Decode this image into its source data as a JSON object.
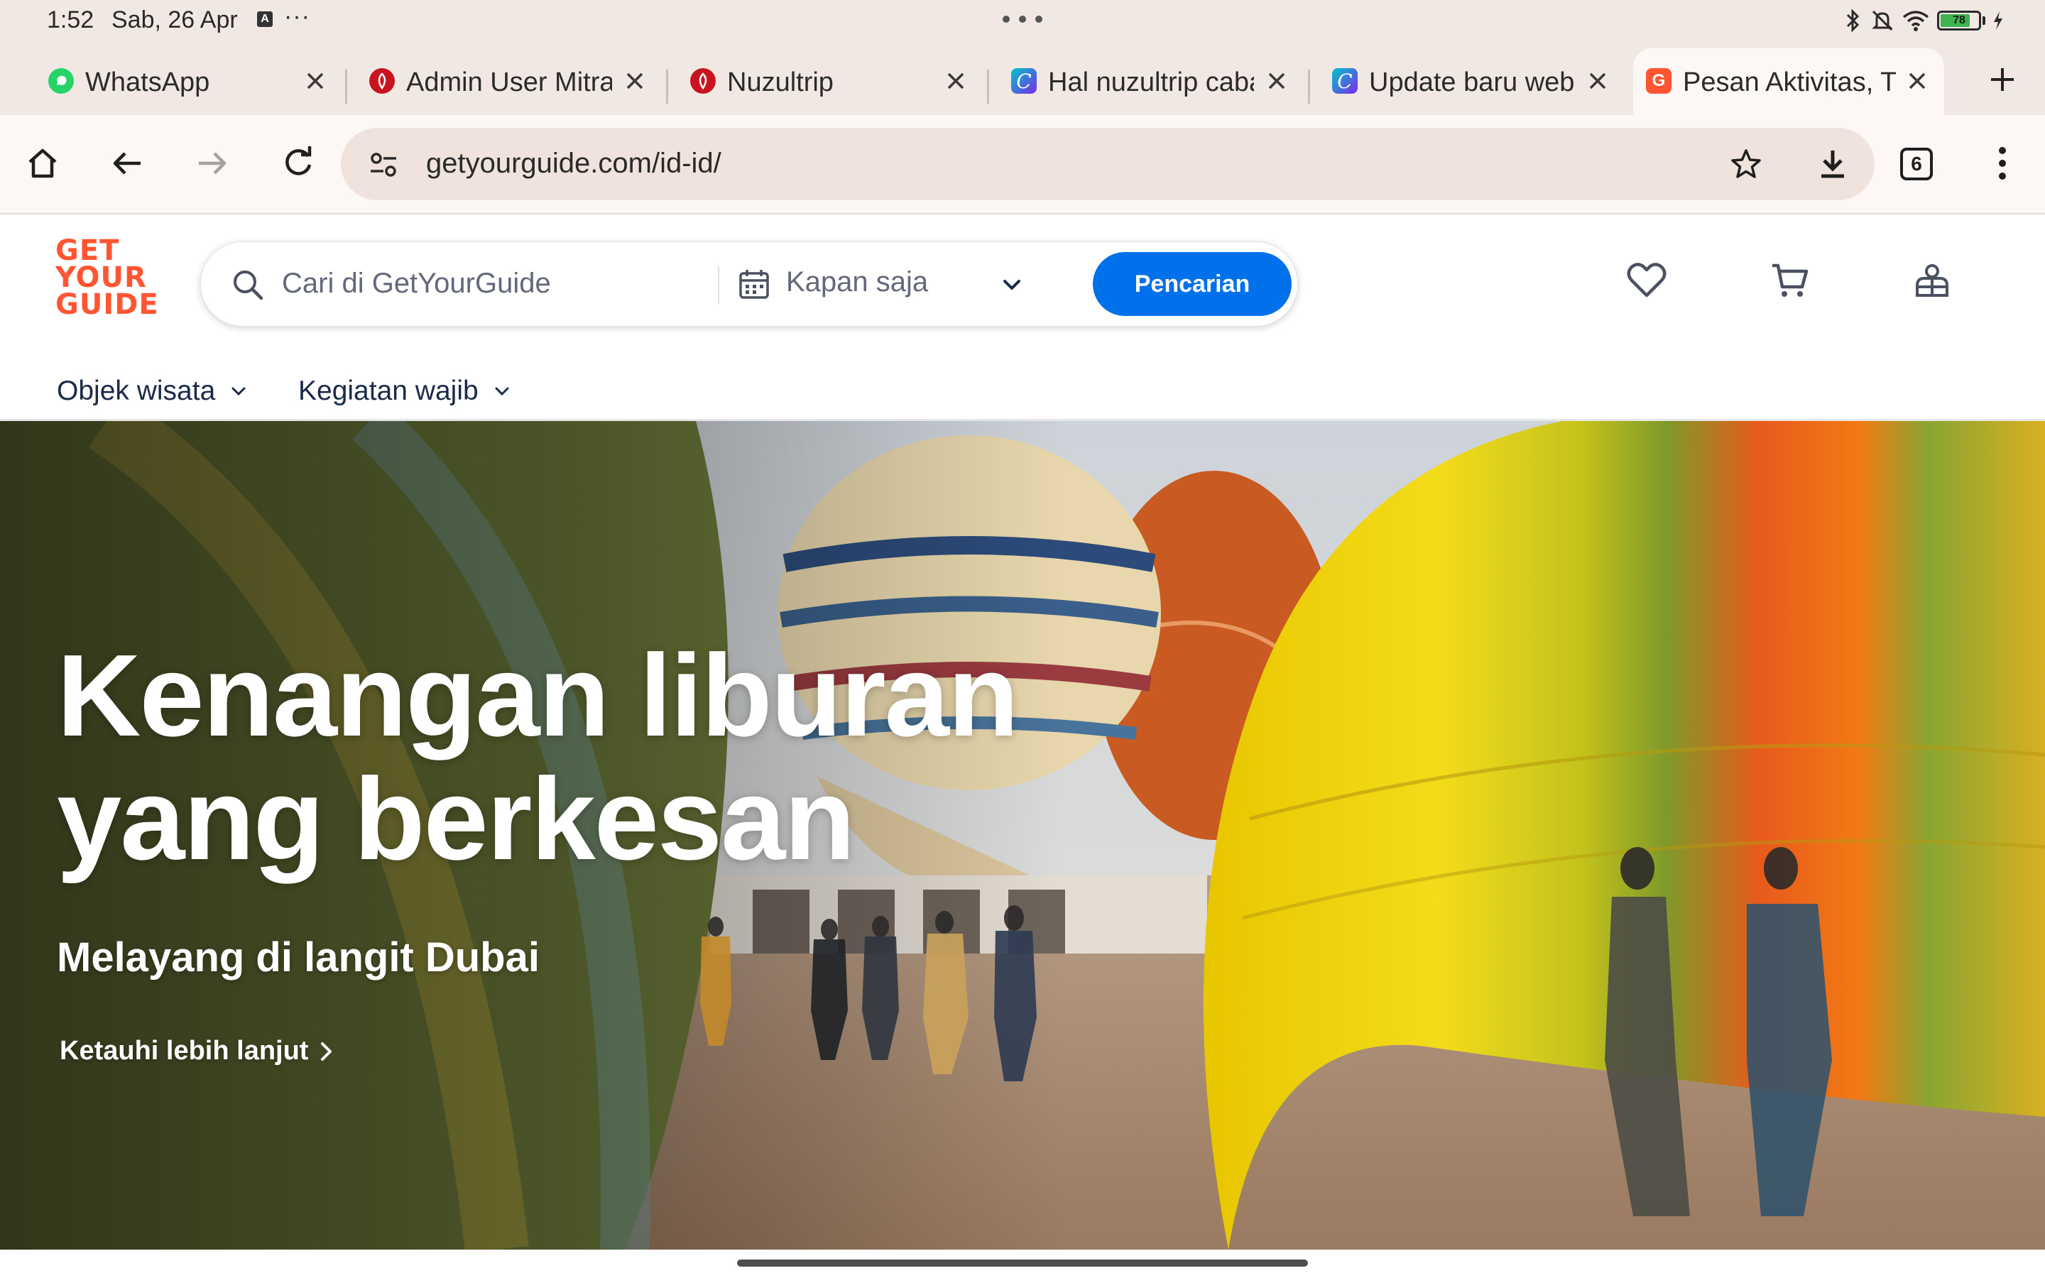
{
  "status_bar": {
    "time": "1:52",
    "date": "Sab, 26 Apr",
    "notification_icon": "A",
    "more": "···",
    "battery_percent": "78",
    "battery_level": 0.78,
    "icons": [
      "bluetooth-icon",
      "bell-off-icon",
      "wifi-icon",
      "battery-icon",
      "charging-icon"
    ]
  },
  "tabs": [
    {
      "label": "WhatsApp",
      "favicon": "whatsapp-icon"
    },
    {
      "label": "Admin User Mitra",
      "favicon": "nuzultrip-icon"
    },
    {
      "label": "Nuzultrip",
      "favicon": "nuzultrip-icon"
    },
    {
      "label": "Hal nuzultrip cabang",
      "favicon": "canva-icon"
    },
    {
      "label": "Update baru web d",
      "favicon": "canva-icon"
    },
    {
      "label": "Pesan Aktivitas, Ti",
      "favicon": "getyourguide-icon",
      "active": true
    }
  ],
  "browser": {
    "url": "getyourguide.com/id-id/",
    "tab_count": "6"
  },
  "site": {
    "logo_lines": [
      "GET",
      "YOUR",
      "GUIDE"
    ],
    "search_placeholder": "Cari di GetYourGuide",
    "date_label": "Kapan saja",
    "search_button": "Pencarian",
    "subnav": [
      "Objek wisata",
      "Kegiatan wajib"
    ],
    "brand_color": "#ff5533",
    "accent_color": "#0071eb"
  },
  "hero": {
    "title_line1": "Kenangan liburan",
    "title_line2": "yang berkesan",
    "subtitle": "Melayang di langit Dubai",
    "link": "Ketauhi lebih lanjut"
  }
}
